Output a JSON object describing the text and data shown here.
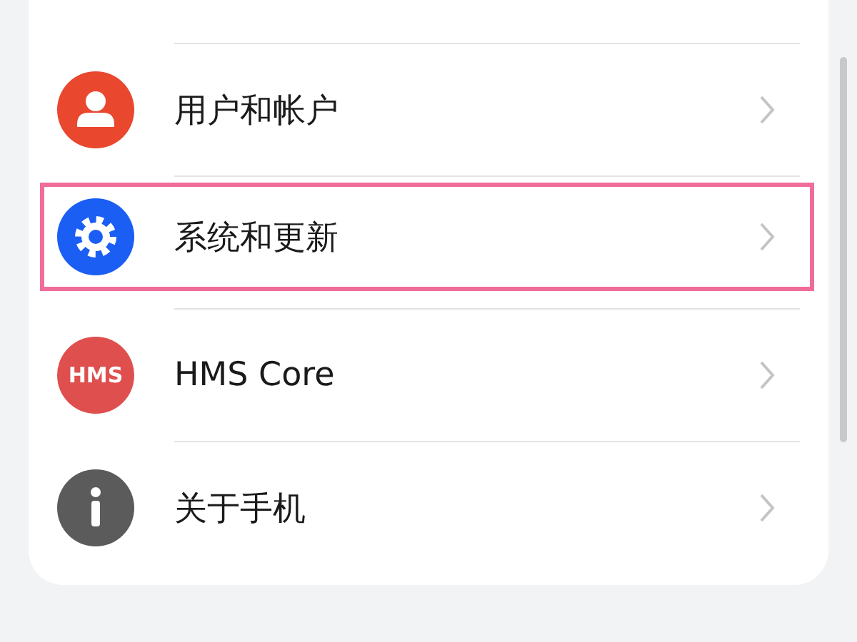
{
  "settings": {
    "items": [
      {
        "label": "用户和帐户",
        "kind": "user",
        "color": "#e9472e",
        "highlighted": false
      },
      {
        "label": "系统和更新",
        "kind": "gear",
        "color": "#1b5ef4",
        "highlighted": true
      },
      {
        "label": "HMS Core",
        "kind": "hms",
        "icon_text": "HMS",
        "color": "#de4f4e",
        "highlighted": false
      },
      {
        "label": "关于手机",
        "kind": "info",
        "color": "#5b5b5b",
        "highlighted": false
      }
    ]
  }
}
